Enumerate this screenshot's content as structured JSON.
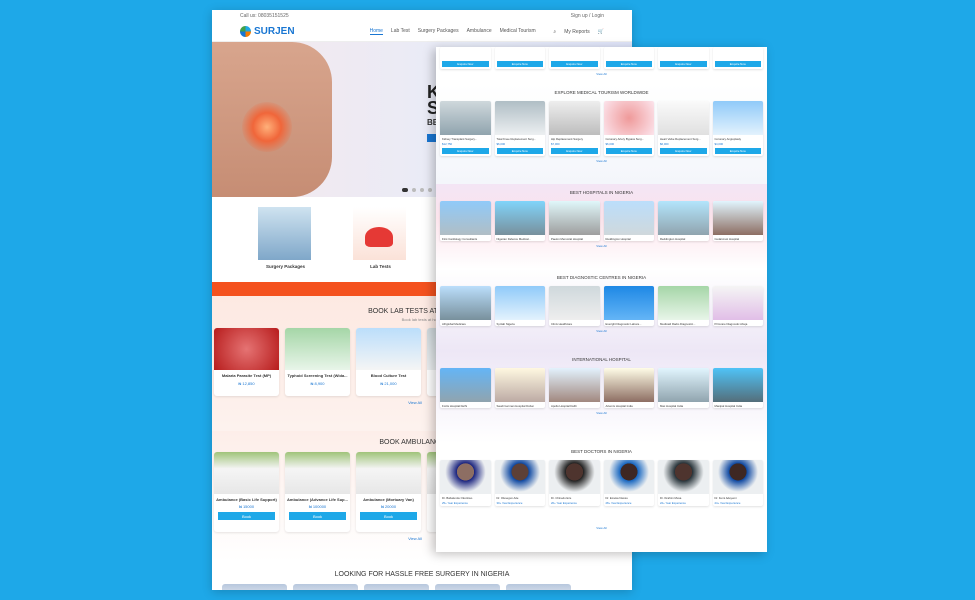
{
  "left": {
    "topbar": {
      "call": "Call us: 08035151525",
      "signup": "Sign up / Login"
    },
    "logo": "SURJEN",
    "nav": [
      "Home",
      "Lab Test",
      "Surgery Packages",
      "Ambulance",
      "Medical Tourism"
    ],
    "nav_right": {
      "reports": "My Reports"
    },
    "hero": {
      "title_1": "K",
      "title_2": "SU",
      "subtitle": "BES"
    },
    "services": [
      {
        "label": "Surgery Packages"
      },
      {
        "label": "Lab Tests"
      }
    ],
    "lab": {
      "title": "BOOK LAB TESTS AT HOME IN A",
      "subtitle": "Book lab tests at home",
      "cards": [
        {
          "name": "Malaria Parasite Test (MP)",
          "price": "₦ 12,850"
        },
        {
          "name": "Typhoid Screening Test (Wida...",
          "price": "₦ 8,900"
        },
        {
          "name": "Blood Culture Test",
          "price": "₦ 21,000"
        },
        {
          "name": "Kidn",
          "price": ""
        }
      ],
      "view_all": "View All"
    },
    "ambulance": {
      "title": "BOOK AMBULANCE IN AB",
      "cards": [
        {
          "name": "Ambulance (Basic Life Support)",
          "price": "₦ 15000",
          "btn": "Book"
        },
        {
          "name": "Ambulance (Advance Life Sup...",
          "price": "₦ 100000",
          "btn": "Book"
        },
        {
          "name": "Ambulance (Mortuary Van)",
          "price": "₦ 20000",
          "btn": "Book"
        },
        {
          "name": "A",
          "price": "",
          "btn": ""
        }
      ],
      "view_all": "View All"
    },
    "surgery": {
      "title": "LOOKING FOR HASSLE FREE SURGERY IN NIGERIA"
    }
  },
  "right": {
    "top_view_all": "View All",
    "tourism": {
      "title": "EXPLORE MEDICAL TOURISM WORLDWIDE",
      "cards": [
        {
          "name": "Kidney Transplant Surgery...",
          "price": "$12,750",
          "btn": "Enquire Now"
        },
        {
          "name": "Total Knee Replacement Surg...",
          "price": "$6,000",
          "btn": "Enquire Now"
        },
        {
          "name": "Hip Replacement Surgery",
          "price": "$7,000",
          "btn": "Enquire Now"
        },
        {
          "name": "Coronary Artery Bypass Surg...",
          "price": "$6,000",
          "btn": "Enquire Now"
        },
        {
          "name": "Heart Valve Replacement Surg...",
          "price": "$6,000",
          "btn": "Enquire Now"
        },
        {
          "name": "Coronary Angioplasty",
          "price": "$4,000",
          "btn": "Enquire Now"
        }
      ],
      "view_all": "View All"
    },
    "hospitals": {
      "title": "BEST HOSPITALS IN NIGERIA",
      "cards": [
        "First Cardiology Consultants",
        "Nigerian Defence Medical...",
        "Paelon Memorial Hospital",
        "Reddington Hospital",
        "Reddington Hospital",
        "Cedarcrest Hospital"
      ],
      "view_all": "View All"
    },
    "diagnostic": {
      "title": "BEST DIAGNOSTIC CENTRES IN NIGERIA",
      "cards": [
        "Afriglobal Medicare",
        "Synlab Nigeria",
        "Clinix Healthcare",
        "Everight Diagnostic Labora...",
        "Medicaid Radio Diagnostic...",
        "Primcare Diagnostic Abuja"
      ],
      "view_all": "View All"
    },
    "international": {
      "title": "INTERNATIONAL HOSPITAL",
      "cards": [
        "Fortis Hospital Delhi",
        "Saudi German Hospital Dubai",
        "Apollo Hospital Delhi",
        "Artemis Hospital India",
        "Max Hospital India",
        "Manipal Hospital India"
      ],
      "view_all": "View All"
    },
    "doctors": {
      "title": "BEST DOCTORS IN NIGERIA",
      "cards": [
        {
          "name": "Dr. Babatunde Okonkwo",
          "exp": "25+ Year Experience"
        },
        {
          "name": "Dr. Olusegun Ade",
          "exp": "30+ Year Experience"
        },
        {
          "name": "Dr. Chinedu Eze",
          "exp": "20+ Year Experience"
        },
        {
          "name": "Dr. Emeka Nwosu",
          "exp": "28+ Year Experience"
        },
        {
          "name": "Dr. Ibrahim Musa",
          "exp": "22+ Year Experience"
        },
        {
          "name": "Dr. Femi Adeyemi",
          "exp": "24+ Year Experience"
        }
      ],
      "view_all": "View All"
    }
  }
}
